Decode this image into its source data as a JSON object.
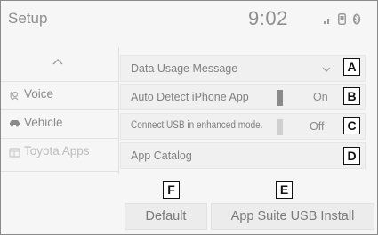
{
  "header": {
    "title": "Setup",
    "time": "9:02",
    "status_icons": [
      "signal-icon",
      "phone-icon",
      "bluetooth-icon"
    ]
  },
  "sidebar": {
    "items": [
      {
        "label": "Voice",
        "icon": "voice-icon"
      },
      {
        "label": "Vehicle",
        "icon": "car-icon"
      },
      {
        "label": "Toyota Apps",
        "icon": "apps-icon",
        "selected": true
      }
    ]
  },
  "settings": {
    "data_usage": {
      "label": "Data Usage Message"
    },
    "auto_detect": {
      "label": "Auto Detect iPhone App",
      "value": "On"
    },
    "connect_usb": {
      "label": "Connect USB in enhanced mode.",
      "value": "Off"
    },
    "app_catalog": {
      "label": "App Catalog"
    }
  },
  "buttons": {
    "default_label": "Default",
    "install_label": "App Suite USB Install"
  },
  "callouts": [
    "A",
    "B",
    "C",
    "D",
    "E",
    "F"
  ],
  "colors": {
    "toggle_on": "#8a8a8a",
    "toggle_off": "#d0d0d0"
  }
}
